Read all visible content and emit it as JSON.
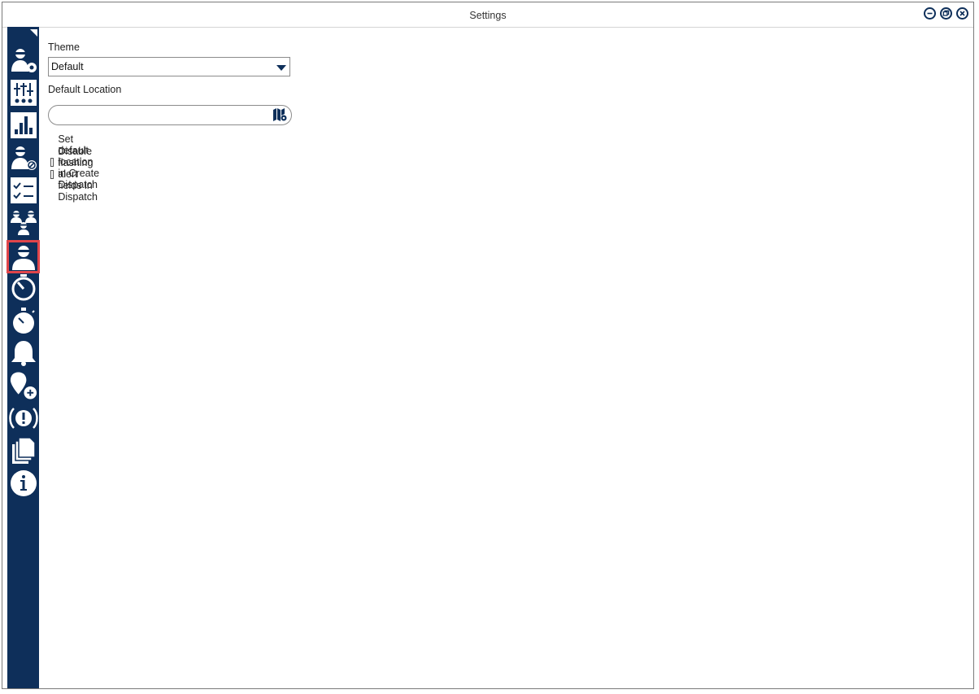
{
  "window": {
    "title": "Settings"
  },
  "window_controls": [
    "minimize-icon",
    "restore-icon",
    "close-icon"
  ],
  "sidebar": {
    "items": [
      {
        "name": "user-settings-icon"
      },
      {
        "name": "sliders-icon"
      },
      {
        "name": "bar-chart-icon"
      },
      {
        "name": "user-blocked-icon"
      },
      {
        "name": "checklist-icon"
      },
      {
        "name": "users-group-icon"
      },
      {
        "name": "user-profile-icon",
        "selected": true
      },
      {
        "name": "timer-icon"
      },
      {
        "name": "stopwatch-icon"
      },
      {
        "name": "bell-icon"
      },
      {
        "name": "add-location-icon"
      },
      {
        "name": "alert-icon"
      },
      {
        "name": "documents-icon"
      },
      {
        "name": "info-icon"
      }
    ]
  },
  "settings": {
    "theme_label": "Theme",
    "theme_value": "Default",
    "default_location_label": "Default Location",
    "default_location_value": "",
    "checkbox_set_default_label": "Set default location in Create Dispatch",
    "checkbox_set_default_checked": false,
    "checkbox_disable_flashing_label": "Disable flashing alert fields in Dispatch",
    "checkbox_disable_flashing_checked": false
  },
  "colors": {
    "sidebar": "#0e2f5a",
    "selected_outline": "#e0454a"
  }
}
